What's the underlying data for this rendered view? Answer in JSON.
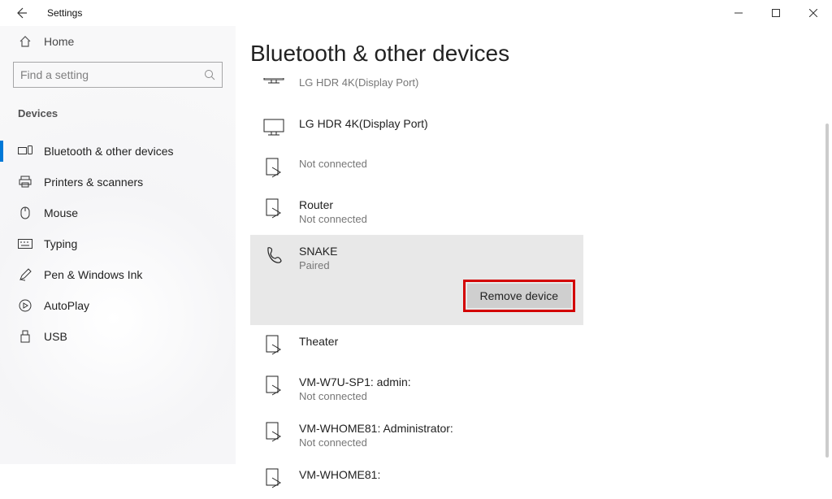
{
  "titlebar": {
    "title": "Settings"
  },
  "sidebar": {
    "home": "Home",
    "search_placeholder": "Find a setting",
    "section": "Devices",
    "items": [
      {
        "label": "Bluetooth & other devices"
      },
      {
        "label": "Printers & scanners"
      },
      {
        "label": "Mouse"
      },
      {
        "label": "Typing"
      },
      {
        "label": "Pen & Windows Ink"
      },
      {
        "label": "AutoPlay"
      },
      {
        "label": "USB"
      }
    ]
  },
  "main": {
    "heading": "Bluetooth & other devices",
    "devices": [
      {
        "name": "LG HDR 4K(Display Port)",
        "status": ""
      },
      {
        "name": "LG HDR 4K(Display Port)",
        "status": ""
      },
      {
        "name": "",
        "status": "Not connected"
      },
      {
        "name": "Router",
        "status": "Not connected"
      },
      {
        "name": "SNAKE",
        "status": "Paired"
      },
      {
        "name": "Theater",
        "status": ""
      },
      {
        "name": "VM-W7U-SP1: admin:",
        "status": "Not connected"
      },
      {
        "name": "VM-WHOME81: Administrator:",
        "status": "Not connected"
      },
      {
        "name": "VM-WHOME81:",
        "status": ""
      }
    ],
    "remove_label": "Remove device"
  }
}
